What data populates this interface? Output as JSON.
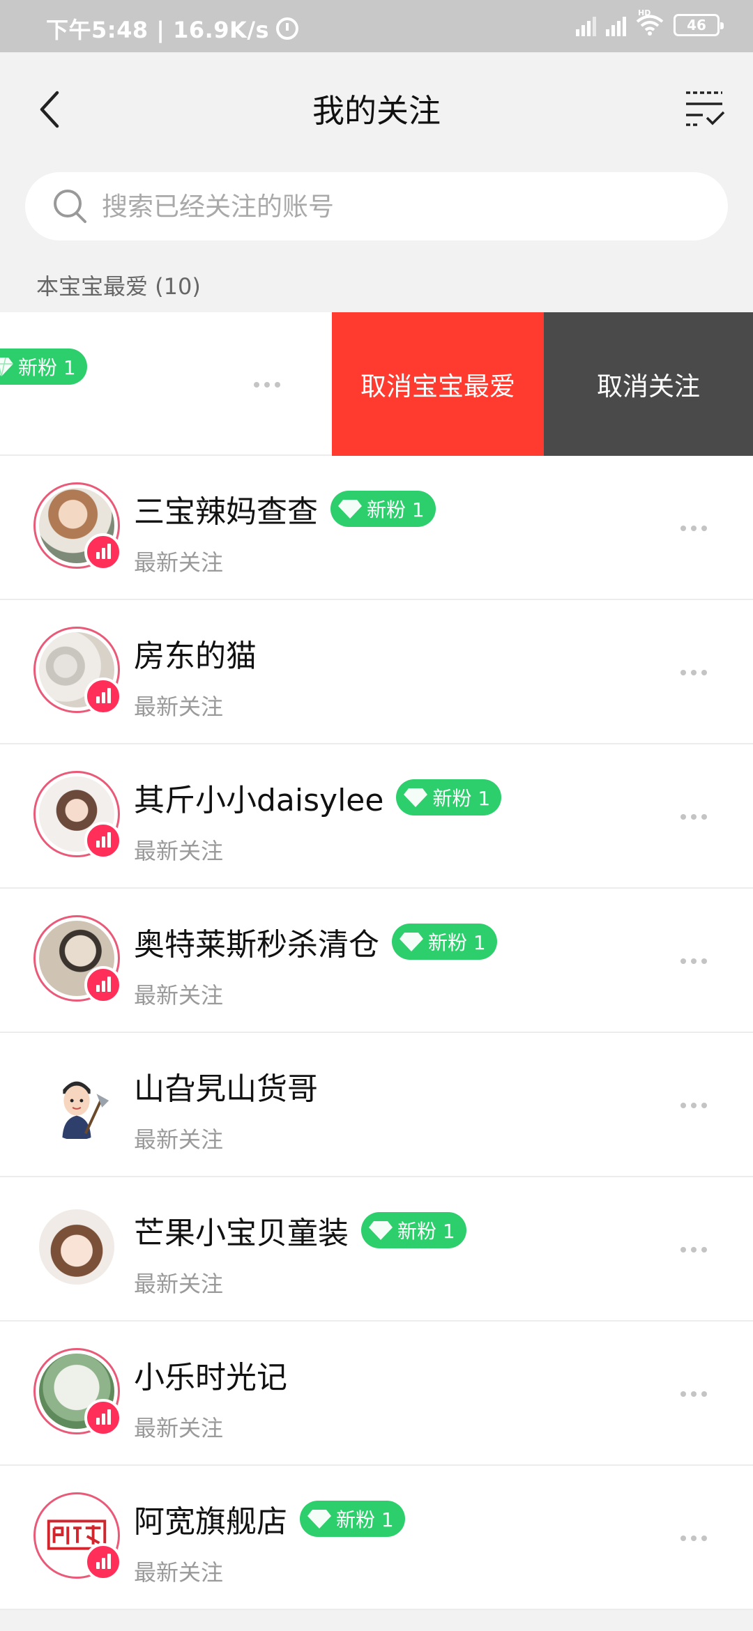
{
  "status_bar": {
    "time_speed": "下午5:48 | 16.9K/s",
    "hd": "HD",
    "battery": "46"
  },
  "header": {
    "title": "我的关注"
  },
  "search": {
    "placeholder": "搜索已经关注的账号"
  },
  "section": {
    "label": "本宝宝最爱 (10)"
  },
  "swiped_row": {
    "badge": "新粉 1",
    "action_remove_favorite": "取消宝宝最爱",
    "action_unfollow": "取消关注"
  },
  "colors": {
    "badge_green": "#2ccf6b",
    "action_red": "#ff3b30",
    "action_dark": "#4a4a4a",
    "live_pink": "#ff2f5a"
  },
  "list": [
    {
      "name": "三宝辣妈查查",
      "sub": "最新关注",
      "badge": "新粉 1",
      "live": true
    },
    {
      "name": "房东的猫",
      "sub": "最新关注",
      "badge": "",
      "live": true
    },
    {
      "name": "其斤小小daisylee",
      "sub": "最新关注",
      "badge": "新粉 1",
      "live": true
    },
    {
      "name": "奥特莱斯秒杀清仓",
      "sub": "最新关注",
      "badge": "新粉 1",
      "live": true
    },
    {
      "name": "山旮旯山货哥",
      "sub": "最新关注",
      "badge": "",
      "live": false
    },
    {
      "name": "芒果小宝贝童装",
      "sub": "最新关注",
      "badge": "新粉 1",
      "live": false
    },
    {
      "name": "小乐时光记",
      "sub": "最新关注",
      "badge": "",
      "live": true
    },
    {
      "name": "阿宽旗舰店",
      "sub": "最新关注",
      "badge": "新粉 1",
      "live": true
    }
  ]
}
